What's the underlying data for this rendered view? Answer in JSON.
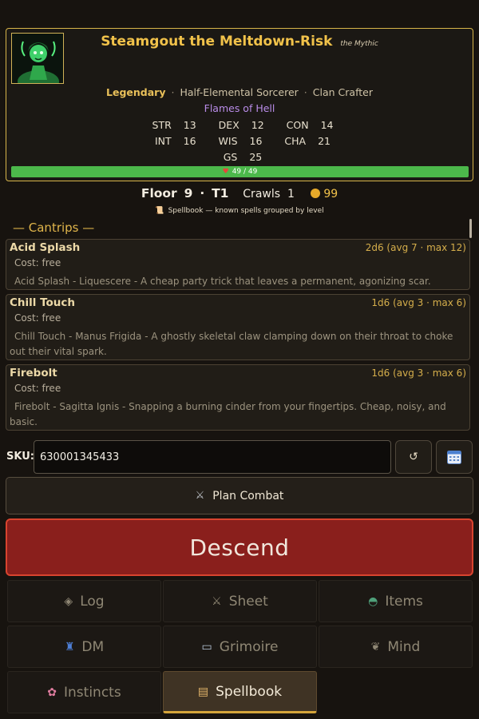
{
  "character": {
    "name": "Steamgout the Meltdown-Risk",
    "epithet": "the Mythic",
    "rarity": "Legendary",
    "class": "Half-Elemental Sorcerer",
    "clan": "Clan Crafter",
    "title": "Flames of Hell",
    "stats": {
      "str_label": "STR",
      "str": "13",
      "dex_label": "DEX",
      "dex": "12",
      "con_label": "CON",
      "con": "14",
      "int_label": "INT",
      "int": "16",
      "wis_label": "WIS",
      "wis": "16",
      "cha_label": "CHA",
      "cha": "21",
      "gs_label": "GS",
      "gs": "25"
    },
    "hp": {
      "text": "49 / 49",
      "current": 49,
      "max": 49,
      "fraction": 1.0,
      "color": "#4cb84b"
    }
  },
  "status": {
    "floor_label": "Floor",
    "floor": "9",
    "sep": "·",
    "tier": "T1",
    "crawls_label": "Crawls",
    "crawls": "1",
    "gold": "99"
  },
  "spellbook": {
    "hint": "Spellbook — known spells grouped by level",
    "level_heading": "— Cantrips —",
    "spells": [
      {
        "name": "Acid Splash",
        "dice": "2d6  (avg 7 · max 12)",
        "cost": "Cost: free",
        "text": "Acid Splash - Liquescere - A cheap party trick that leaves a permanent, agonizing scar."
      },
      {
        "name": "Chill Touch",
        "dice": "1d6  (avg 3 · max 6)",
        "cost": "Cost: free",
        "text": "Chill Touch - Manus Frigida - A ghostly skeletal claw clamping down on their throat to choke out their vital spark."
      },
      {
        "name": "Firebolt",
        "dice": "1d6  (avg 3 · max 6)",
        "cost": "Cost: free",
        "text": "Firebolt - Sagitta Ignis - Snapping a burning cinder from your fingertips. Cheap, noisy, and basic."
      }
    ]
  },
  "sku": {
    "label": "SKU:",
    "value": "630001345433"
  },
  "actions": {
    "plan_combat": "Plan Combat",
    "descend": "Descend"
  },
  "nav": {
    "log": "Log",
    "sheet": "Sheet",
    "items": "Items",
    "dm": "DM",
    "grimoire": "Grimoire",
    "mind": "Mind",
    "instincts": "Instincts",
    "spellbook": "Spellbook"
  },
  "colors": {
    "accent_gold": "#f1c24a",
    "descend_red": "#8a1f1c",
    "title_purple": "#b98ce8",
    "hp_green": "#4cb84b"
  }
}
